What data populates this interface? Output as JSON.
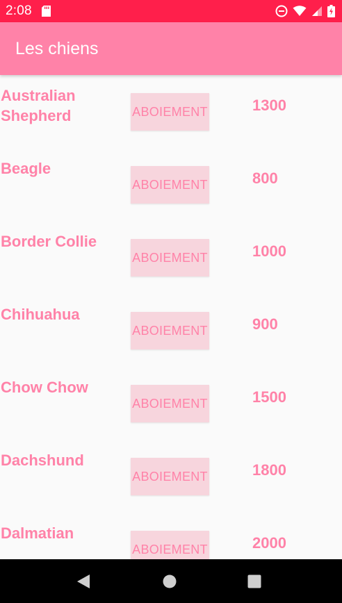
{
  "status_bar": {
    "time": "2:08",
    "icons": [
      "sd-card-icon",
      "do-not-disturb-icon",
      "wifi-icon",
      "cell-signal-icon",
      "battery-icon"
    ],
    "background": "#FF1F4B"
  },
  "app_bar": {
    "title": "Les chiens",
    "background": "#FF82A8"
  },
  "dogs": [
    {
      "name": "Australian Shepherd",
      "button": "ABOIEMENT",
      "price": "1300"
    },
    {
      "name": "Beagle",
      "button": "ABOIEMENT",
      "price": "800"
    },
    {
      "name": "Border Collie",
      "button": "ABOIEMENT",
      "price": "1000"
    },
    {
      "name": "Chihuahua",
      "button": "ABOIEMENT",
      "price": "900"
    },
    {
      "name": "Chow Chow",
      "button": "ABOIEMENT",
      "price": "1500"
    },
    {
      "name": "Dachshund",
      "button": "ABOIEMENT",
      "price": "1800"
    },
    {
      "name": "Dalmatian",
      "button": "ABOIEMENT",
      "price": "2000"
    }
  ],
  "nav_bar": {
    "buttons": [
      "back-icon",
      "home-icon",
      "recents-icon"
    ]
  },
  "colors": {
    "accent_pink": "#FF82A8",
    "button_bg": "#F7D5DD",
    "list_bg": "#FAFAFA"
  }
}
